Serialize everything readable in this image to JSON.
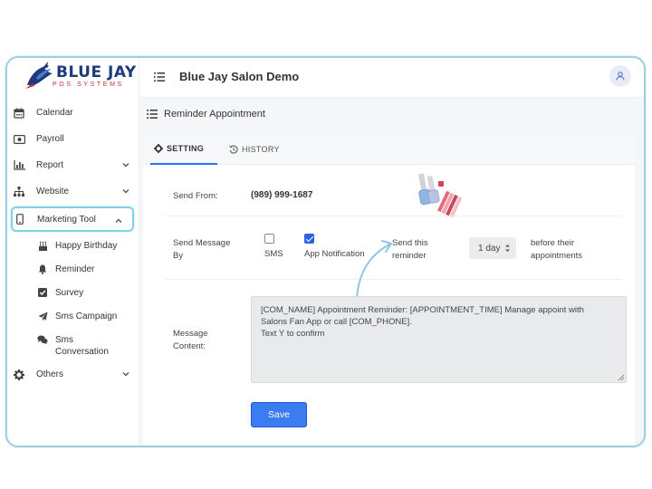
{
  "brand": {
    "name": "BLUE JAY",
    "tagline": "POS SYSTEMS"
  },
  "header": {
    "title": "Blue Jay Salon Demo"
  },
  "sidebar": {
    "items": [
      {
        "label": "Calendar",
        "icon": "calendar-icon"
      },
      {
        "label": "Payroll",
        "icon": "money-icon"
      },
      {
        "label": "Report",
        "icon": "bar-chart-icon",
        "expandable": true
      },
      {
        "label": "Website",
        "icon": "sitemap-icon",
        "expandable": true
      },
      {
        "label": "Marketing Tool",
        "icon": "mobile-icon",
        "expandable": true,
        "expanded": true,
        "active": true
      },
      {
        "label": "Others",
        "icon": "gear-icon",
        "expandable": true
      }
    ],
    "sub_items": [
      {
        "label": "Happy Birthday",
        "icon": "birthday-cake-icon"
      },
      {
        "label": "Reminder",
        "icon": "bell-icon"
      },
      {
        "label": "Survey",
        "icon": "check-square-icon"
      },
      {
        "label": "Sms Campaign",
        "icon": "paper-plane-icon"
      },
      {
        "label": "Sms Conversation",
        "icon": "chat-icon"
      }
    ]
  },
  "page": {
    "section_title": "Reminder Appointment",
    "tabs": [
      {
        "label": "SETTING",
        "active": true,
        "icon": "gear-icon"
      },
      {
        "label": "HISTORY",
        "active": false,
        "icon": "history-icon"
      }
    ],
    "form": {
      "send_from_label": "Send From:",
      "send_from_value": "(989) 999-1687",
      "send_by_label": "Send Message By",
      "sms_label": "SMS",
      "sms_checked": false,
      "app_notification_label": "App Notification",
      "app_notification_checked": true,
      "send_this_label": "Send this reminder",
      "reminder_offset_selected": "1 day",
      "before_label": "before their appointments",
      "message_label": "Message Content:",
      "message_line1": "[COM_NAME]  Appointment Reminder: [APPOINTMENT_TIME] Manage appoint with",
      "message_line2": "Salons Fan App or call [COM_PHONE].",
      "message_line3": "Text Y to confirm",
      "save_label": "Save"
    }
  },
  "colors": {
    "accent": "#3b7df0",
    "brand_blue": "#1e3a7a",
    "brand_red": "#c7302f",
    "highlight": "#7fd3e8"
  }
}
